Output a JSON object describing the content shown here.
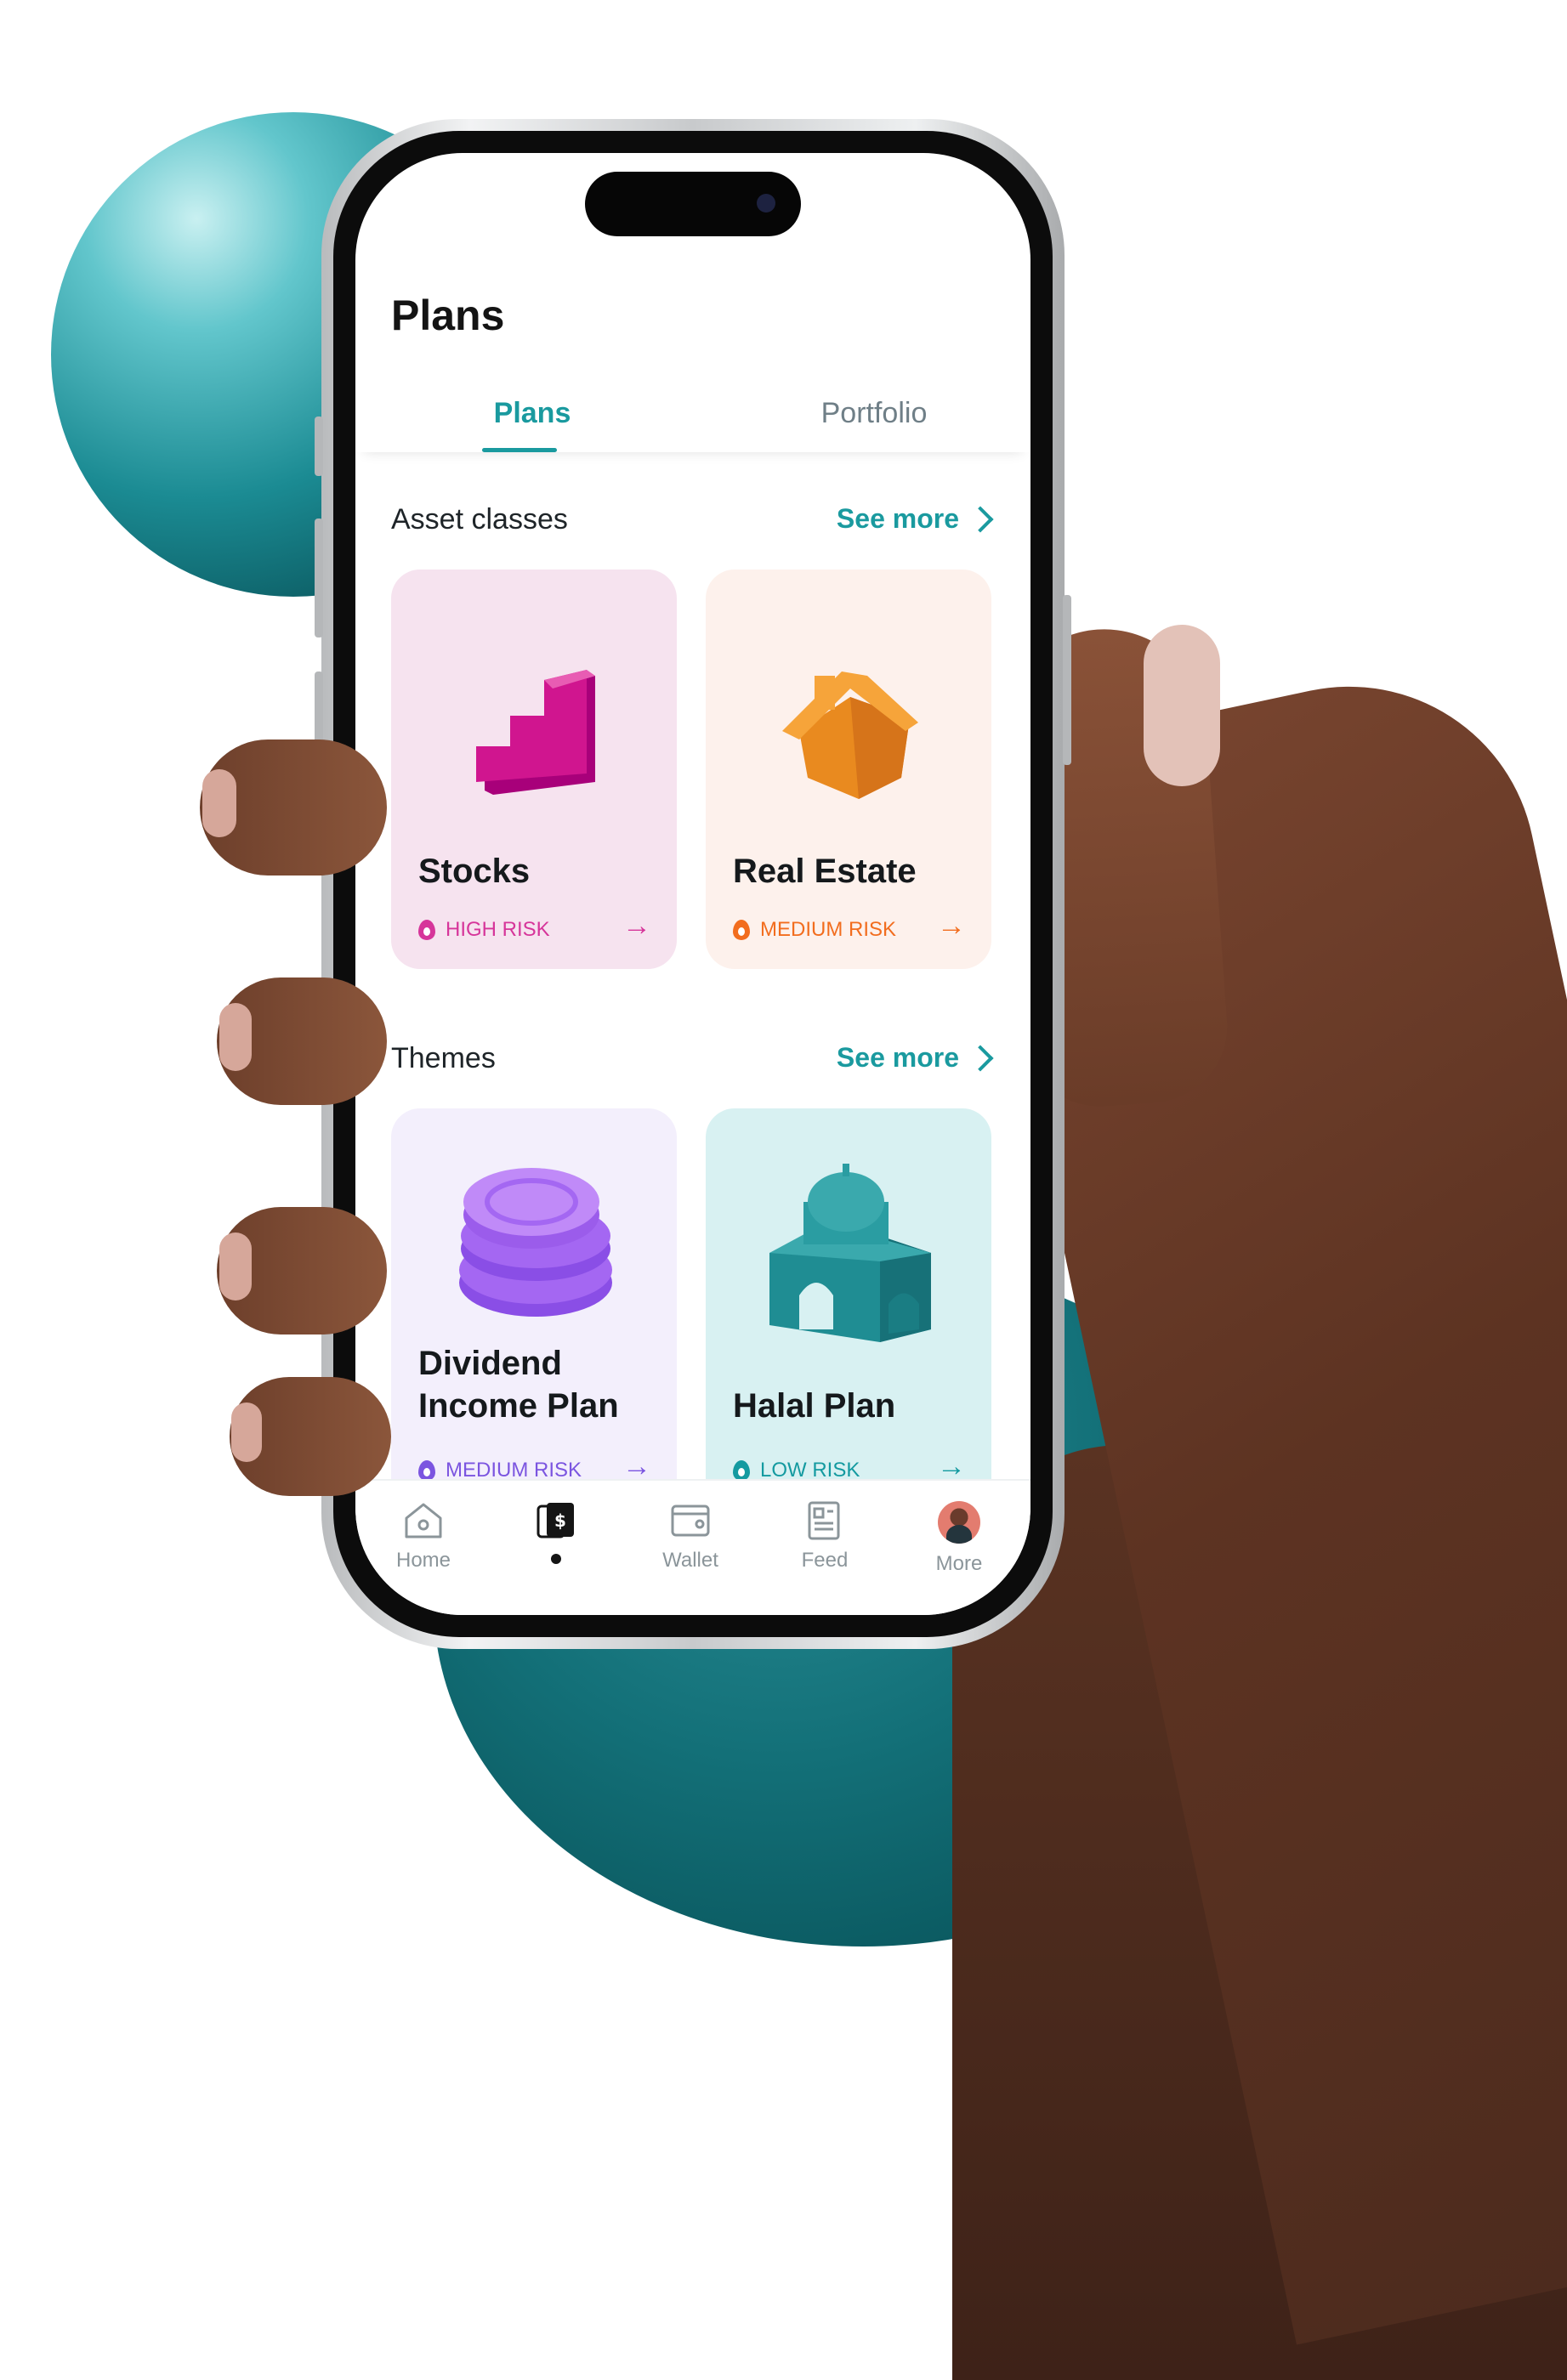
{
  "app": {
    "title": "Plans",
    "tabs": [
      {
        "label": "Plans",
        "active": true
      },
      {
        "label": "Portfolio",
        "active": false
      }
    ]
  },
  "sections": [
    {
      "title": "Asset classes",
      "see_more": "See more",
      "cards": [
        {
          "name": "Stocks",
          "risk": "HIGH RISK",
          "bg": "#f6e3ef",
          "accent": "#d6359a",
          "icon": "pink-stairs-icon"
        },
        {
          "name": "Real Estate",
          "risk": "MEDIUM RISK",
          "bg": "#fdf1ec",
          "accent": "#f26d1e",
          "icon": "orange-house-icon"
        }
      ]
    },
    {
      "title": "Themes",
      "see_more": "See more",
      "cards": [
        {
          "name": "Dividend Income Plan",
          "risk": "MEDIUM RISK",
          "bg": "#f3effc",
          "accent": "#7b55e0",
          "icon": "purple-coins-icon"
        },
        {
          "name": "Halal Plan",
          "risk": "LOW RISK",
          "bg": "#d8f1f2",
          "accent": "#149aa0",
          "icon": "teal-mosque-icon"
        }
      ]
    }
  ],
  "bottom_nav": [
    {
      "label": "Home",
      "icon": "home-icon"
    },
    {
      "label": "",
      "icon": "plans-dollar-icon",
      "active": true
    },
    {
      "label": "Wallet",
      "icon": "wallet-icon"
    },
    {
      "label": "Feed",
      "icon": "feed-icon"
    },
    {
      "label": "More",
      "icon": "avatar"
    }
  ],
  "colors": {
    "brand": "#1a9a9f",
    "text": "#141414",
    "muted": "#8b959a"
  }
}
